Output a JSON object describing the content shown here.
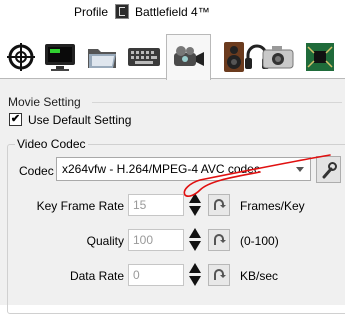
{
  "header": {
    "profile_label": "Profile",
    "profile_value": "Battlefield 4™"
  },
  "tabs": [
    {
      "icon": "crosshair-icon"
    },
    {
      "icon": "monitor-icon"
    },
    {
      "icon": "folder-icon"
    },
    {
      "icon": "keyboard-icon"
    },
    {
      "icon": "video-camera-icon",
      "active": true
    },
    {
      "icon": "speaker-icon"
    },
    {
      "icon": "headset-icon"
    },
    {
      "icon": "camera-icon"
    },
    {
      "icon": "circuit-board-icon"
    }
  ],
  "movie_setting": {
    "title": "Movie Setting",
    "use_default_label": "Use Default Setting",
    "use_default_checked": true,
    "check_mark": "✔"
  },
  "video_codec": {
    "title": "Video Codec",
    "codec_label": "Codec",
    "codec_value": "x264vfw - H.264/MPEG-4 AVC codec",
    "key_frame_rate": {
      "label": "Key Frame Rate",
      "value": "15",
      "unit": "Frames/Key"
    },
    "quality": {
      "label": "Quality",
      "value": "100",
      "unit": "(0-100)"
    },
    "data_rate": {
      "label": "Data Rate",
      "value": "0",
      "unit": "KB/sec"
    }
  },
  "colors": {
    "annotation": "#e01010",
    "panel_bg": "#f0f0f0"
  }
}
